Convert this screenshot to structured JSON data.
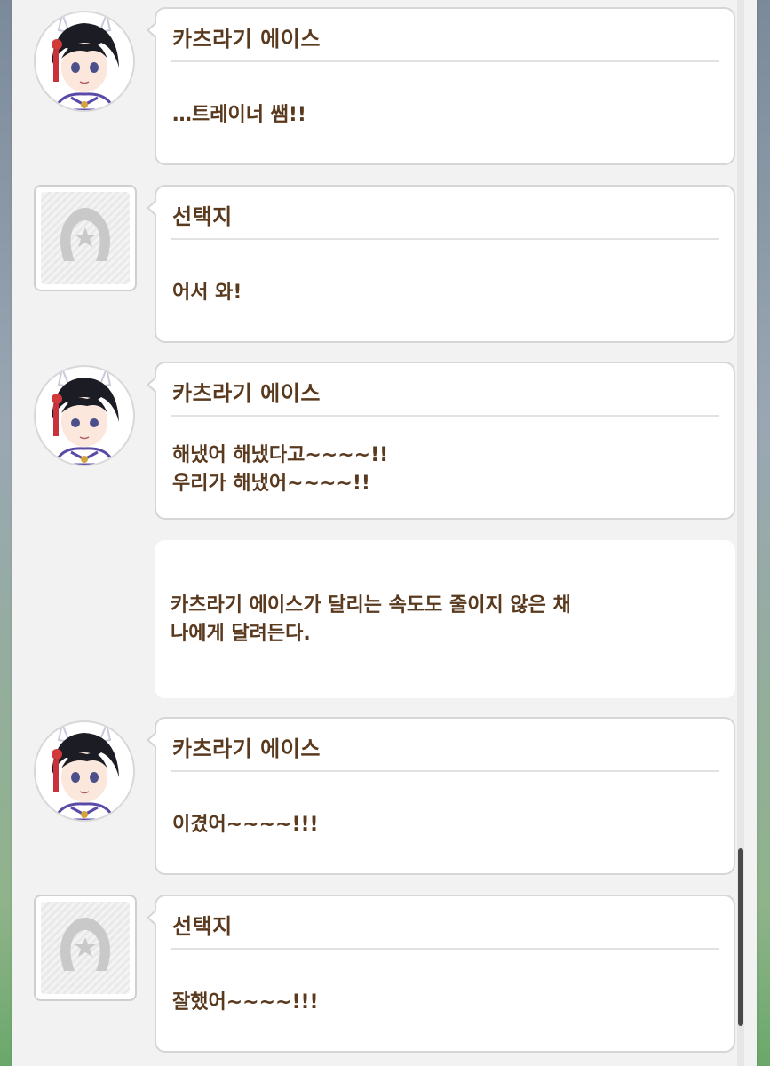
{
  "log": [
    {
      "type": "dialogue",
      "avatar": "character",
      "speaker": "카츠라기 에이스",
      "text": "…트레이너 쌤!!"
    },
    {
      "type": "dialogue",
      "avatar": "choice-placeholder",
      "speaker": "선택지",
      "text": "어서 와!"
    },
    {
      "type": "dialogue",
      "avatar": "character",
      "speaker": "카츠라기 에이스",
      "text": "해냈어 해냈다고~~~~!!\n우리가 해냈어~~~~!!"
    },
    {
      "type": "narration",
      "text": "카츠라기 에이스가 달리는 속도도 줄이지 않은 채\n나에게 달려든다."
    },
    {
      "type": "dialogue",
      "avatar": "character",
      "speaker": "카츠라기 에이스",
      "text": "이겼어~~~~!!!"
    },
    {
      "type": "dialogue",
      "avatar": "choice-placeholder",
      "speaker": "선택지",
      "text": "잘했어~~~~!!!"
    }
  ],
  "scroll": {
    "position_fraction": 0.84
  },
  "colors": {
    "text": "#5a3a1e",
    "panel": "#f2f2f2",
    "bubble": "#ffffff",
    "border": "#d6d6d6"
  }
}
